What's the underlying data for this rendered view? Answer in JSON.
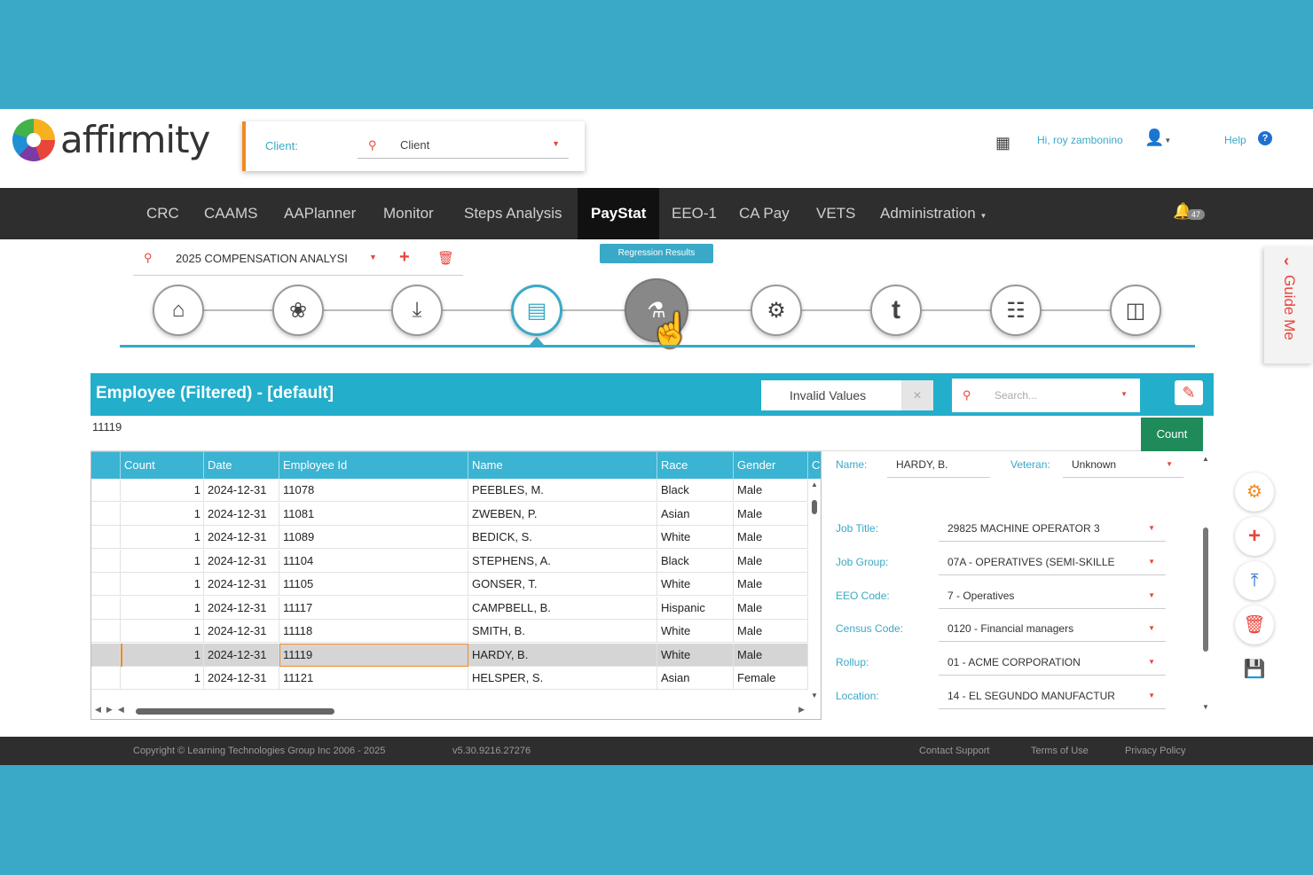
{
  "header": {
    "logo_text": "affirmity",
    "client_label": "Client:",
    "client_value": "Client",
    "greeting": "Hi, roy zambonino",
    "help_label": "Help"
  },
  "nav": {
    "items": [
      "CRC",
      "CAAMS",
      "AAPlanner",
      "Monitor",
      "Steps Analysis",
      "PayStat",
      "EEO-1",
      "CA Pay",
      "VETS",
      "Administration"
    ],
    "active": "PayStat",
    "notification_count": "47"
  },
  "analysis": {
    "name": "2025 COMPENSATION ANALYSI"
  },
  "wizard": {
    "tooltip": "Regression Results",
    "steps": [
      "home-icon",
      "groups-icon",
      "import-icon",
      "employee-card-icon",
      "regression-icon",
      "analysis-icon",
      "t-icon",
      "org-chart-icon",
      "report-icon"
    ],
    "active_step": "employee-card-icon",
    "hover_step": "regression-icon"
  },
  "guide": {
    "label": "Guide Me"
  },
  "panel": {
    "title": "Employee (Filtered) - [default]",
    "filter_value": "Invalid Values",
    "search_placeholder": "Search...",
    "selected_id": "11119",
    "count_button": "Count"
  },
  "grid": {
    "columns": [
      "Count",
      "Date",
      "Employee Id",
      "Name",
      "Race",
      "Gender",
      "C"
    ],
    "rows": [
      {
        "count": "1",
        "date": "2024-12-31",
        "emp": "11078",
        "name": "PEEBLES, M.",
        "race": "Black",
        "gender": "Male"
      },
      {
        "count": "1",
        "date": "2024-12-31",
        "emp": "11081",
        "name": "ZWEBEN, P.",
        "race": "Asian",
        "gender": "Male"
      },
      {
        "count": "1",
        "date": "2024-12-31",
        "emp": "11089",
        "name": "BEDICK, S.",
        "race": "White",
        "gender": "Male"
      },
      {
        "count": "1",
        "date": "2024-12-31",
        "emp": "11104",
        "name": "STEPHENS, A.",
        "race": "Black",
        "gender": "Male"
      },
      {
        "count": "1",
        "date": "2024-12-31",
        "emp": "11105",
        "name": "GONSER, T.",
        "race": "White",
        "gender": "Male"
      },
      {
        "count": "1",
        "date": "2024-12-31",
        "emp": "11117",
        "name": "CAMPBELL, B.",
        "race": "Hispanic",
        "gender": "Male"
      },
      {
        "count": "1",
        "date": "2024-12-31",
        "emp": "11118",
        "name": "SMITH, B.",
        "race": "White",
        "gender": "Male"
      },
      {
        "count": "1",
        "date": "2024-12-31",
        "emp": "11119",
        "name": "HARDY, B.",
        "race": "White",
        "gender": "Male"
      },
      {
        "count": "1",
        "date": "2024-12-31",
        "emp": "11121",
        "name": "HELSPER, S.",
        "race": "Asian",
        "gender": "Female"
      }
    ],
    "selected_row": 7
  },
  "form": {
    "name_label": "Name:",
    "name_value": "HARDY, B.",
    "veteran_label": "Veteran:",
    "veteran_value": "Unknown",
    "fields": [
      {
        "label": "Job Title:",
        "value": "29825 MACHINE OPERATOR 3"
      },
      {
        "label": "Job Group:",
        "value": "07A - OPERATIVES (SEMI-SKILLE"
      },
      {
        "label": "EEO Code:",
        "value": "7 - Operatives"
      },
      {
        "label": "Census Code:",
        "value": "0120 - Financial managers"
      },
      {
        "label": "Rollup:",
        "value": "01 - ACME CORPORATION"
      },
      {
        "label": "Location:",
        "value": "14 - EL SEGUNDO MANUFACTUR"
      }
    ]
  },
  "footer": {
    "copyright": "Copyright © Learning Technologies Group Inc 2006 - 2025",
    "version": "v5.30.9216.27276",
    "contact": "Contact Support",
    "terms": "Terms of Use",
    "privacy": "Privacy Policy"
  },
  "colors": {
    "accent": "#3aa9c7",
    "brand_red": "#e8453c",
    "nav_bg": "#2e2e2e",
    "count_green": "#1f8a5a"
  }
}
